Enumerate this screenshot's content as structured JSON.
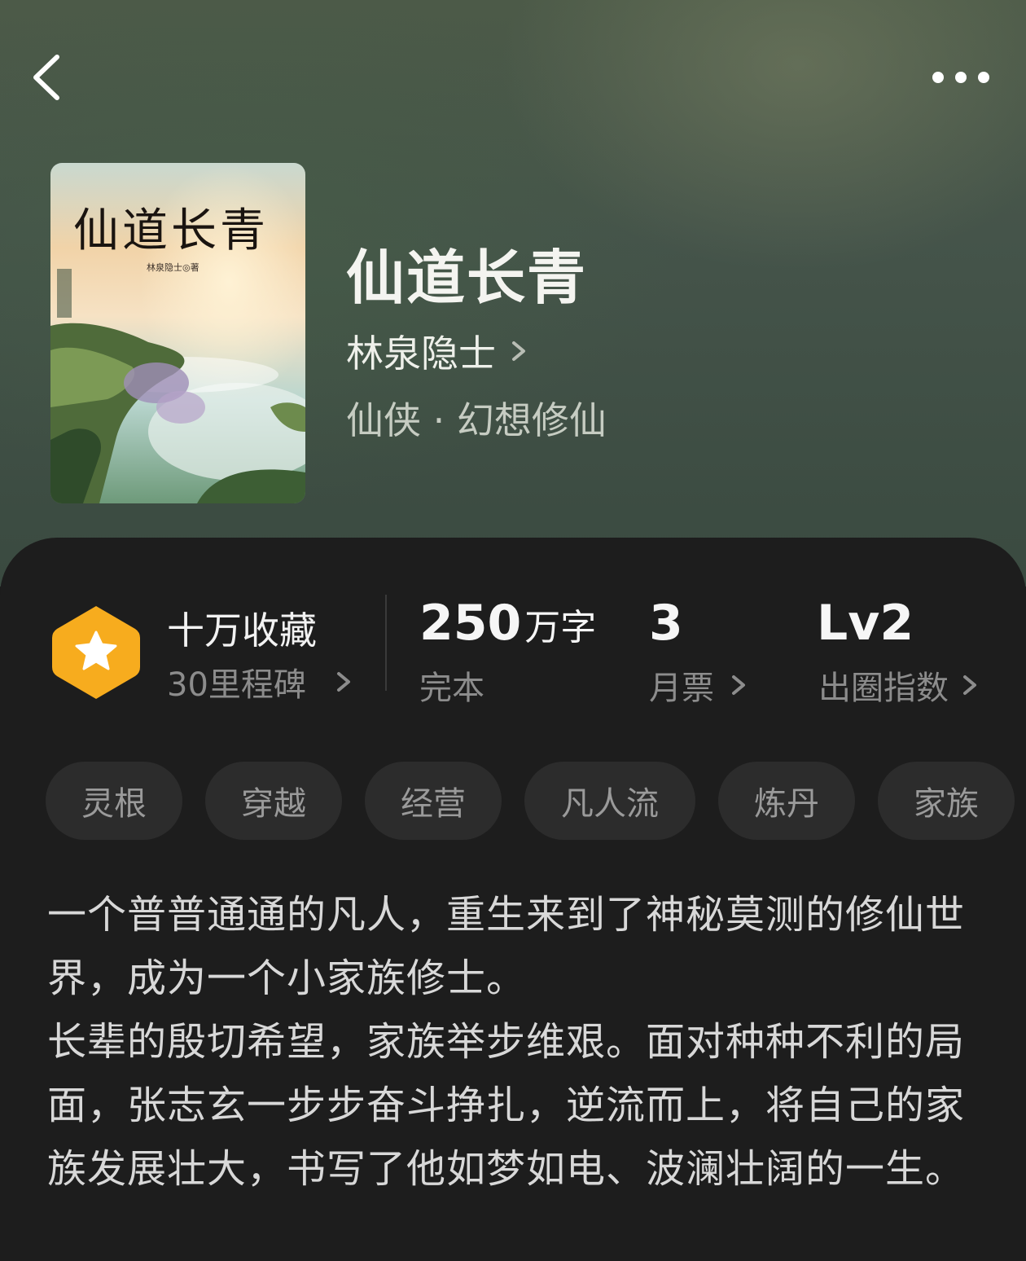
{
  "book": {
    "title": "仙道长青",
    "author": "林泉隐士",
    "genre": "仙侠 · 幻想修仙",
    "cover_title": "仙道长青",
    "cover_author": "林泉隐士◎著"
  },
  "stats": {
    "collect_main": "十万收藏",
    "collect_sub": "30里程碑",
    "words_value": "250",
    "words_unit": "万字",
    "words_label": "完本",
    "tickets_value": "3",
    "tickets_label": "月票",
    "level_value": "Lv2",
    "level_label": "出圈指数"
  },
  "tags": [
    "灵根",
    "穿越",
    "经营",
    "凡人流",
    "炼丹",
    "家族"
  ],
  "description": [
    "一个普普通通的凡人，重生来到了神秘莫测的修仙世界，成为一个小家族修士。",
    "长辈的殷切希望，家族举步维艰。面对种种不利的局面，张志玄一步步奋斗挣扎，逆流而上，将自己的家族发展壮大，书写了他如梦如电、波澜壮阔的一生。"
  ],
  "icons": {
    "back": "chevron-left-icon",
    "more": "more-dots-icon",
    "badge": "star-badge-icon",
    "chevron": "chevron-right-icon"
  },
  "colors": {
    "badge": "#f7ac1e",
    "panel": "#1d1d1d",
    "tag_bg": "#2c2c2c"
  }
}
